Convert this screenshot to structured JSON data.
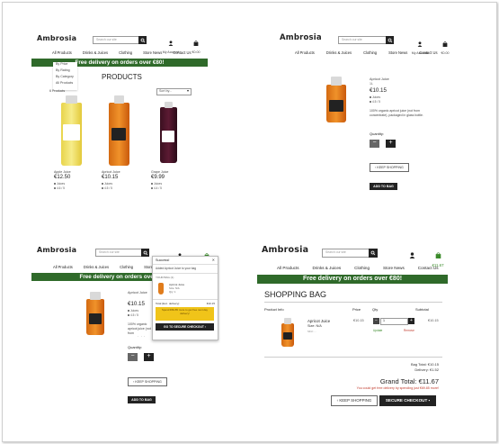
{
  "brand": "Ambrosia",
  "search_placeholder": "Search our site",
  "account_label": "My Account",
  "bag_total": "€0.00",
  "bag_total_filled": "€11.67",
  "nav": [
    "All Products",
    "Drinks & Juices",
    "Clothing",
    "Store News",
    "Contact Us"
  ],
  "banner": "Free delivery on orders over €80!",
  "products_page": {
    "dropdown": [
      "By Price",
      "By Rating",
      "By Category",
      "All Products"
    ],
    "title": "PRODUCTS",
    "count": "6 Products",
    "sort": "Sort by...",
    "items": [
      {
        "name": "Apple Juice",
        "price": "€12.50",
        "cat": "Juices",
        "rating": "4.6 / 5"
      },
      {
        "name": "Apricot Juice",
        "price": "€10.15",
        "cat": "Juices",
        "rating": "4.5 / 5"
      },
      {
        "name": "Grape Juice",
        "price": "€9.99",
        "cat": "Juices",
        "rating": "4.4 / 5"
      }
    ]
  },
  "product_detail": {
    "name": "Apricot Juice",
    "size": "1L",
    "price": "€10.15",
    "cat": "Juices",
    "rating": "4.5 / 5",
    "desc": "100% organic apricot juice (not from concentrate), packaged in glass bottle.",
    "qty_label": "Quantity:",
    "keep": "KEEP SHOPPING",
    "add": "ADD TO BAG"
  },
  "toast": {
    "title": "Success!",
    "close": "✕",
    "msg": "Added Apricot Juice to your bag",
    "your_bag": "YOUR BAG (1)",
    "item_name": "Apricot Juice",
    "item_size": "Size: N/A",
    "item_qty": "Qty: 1",
    "total_label": "Total (Exc. delivery):",
    "total_value": "€10.15",
    "spend": "Spend €69.85 more to get free next day delivery!",
    "checkout": "GO TO SECURE CHECKOUT"
  },
  "bag": {
    "title": "SHOPPING BAG",
    "col_info": "Product Info",
    "col_price": "Price",
    "col_qty": "Qty",
    "col_sub": "Subtotal",
    "item_name": "Apricot Juice",
    "item_size": "Size: N/A",
    "item_sku": "SKU: ...",
    "price": "€10.15",
    "qty": "1",
    "sub": "€10.15",
    "update": "Update",
    "remove": "Remove",
    "bag_total": "Bag Total: €10.15",
    "delivery": "Delivery: €1.52",
    "grand": "Grand Total: €11.67",
    "free_msg": "You could get free delivery by spending just €69.85 more!",
    "keep": "KEEP SHOPPING",
    "checkout": "SECURE CHECKOUT"
  }
}
